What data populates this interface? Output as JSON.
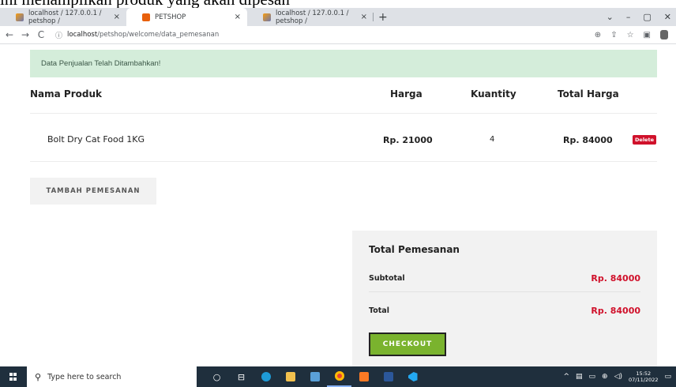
{
  "doc_caption": "ini menampilkan produk yang akan dipesan",
  "browser": {
    "tabs": [
      {
        "title": "localhost / 127.0.0.1 / petshop / ",
        "close": "×"
      },
      {
        "title": "PETSHOP",
        "close": "×"
      },
      {
        "title": "localhost / 127.0.0.1 / petshop / ",
        "close": "×"
      }
    ],
    "new_tab": "+",
    "window_controls": [
      "⌄",
      "–",
      "▢",
      "✕"
    ],
    "url_host": "localhost",
    "url_path": "/petshop/welcome/data_pemesanan",
    "nav": [
      "←",
      "→",
      "C"
    ]
  },
  "alert": "Data Penjualan Telah Ditambahkan!",
  "table": {
    "headers": [
      "Nama Produk",
      "Harga",
      "Kuantity",
      "Total Harga"
    ],
    "rows": [
      {
        "nama": "Bolt Dry Cat Food 1KG",
        "harga": "Rp. 21000",
        "kuantity": "4",
        "total": "Rp. 84000",
        "action": "Delete"
      }
    ]
  },
  "tambah_button": "TAMBAH PEMESANAN",
  "summary": {
    "title": "Total Pemesanan",
    "subtotal_label": "Subtotal",
    "subtotal_value": "Rp. 84000",
    "total_label": "Total",
    "total_value": "Rp. 84000",
    "checkout_label": "CHECKOUT"
  },
  "taskbar": {
    "search_placeholder": "Type here to search",
    "time": "15:52",
    "date": "07/11/2022"
  },
  "colors": {
    "alert_bg": "#d4edda",
    "price_red": "#d0112b",
    "checkout_green": "#7ab32e",
    "taskbar": "#1f2f3d"
  }
}
